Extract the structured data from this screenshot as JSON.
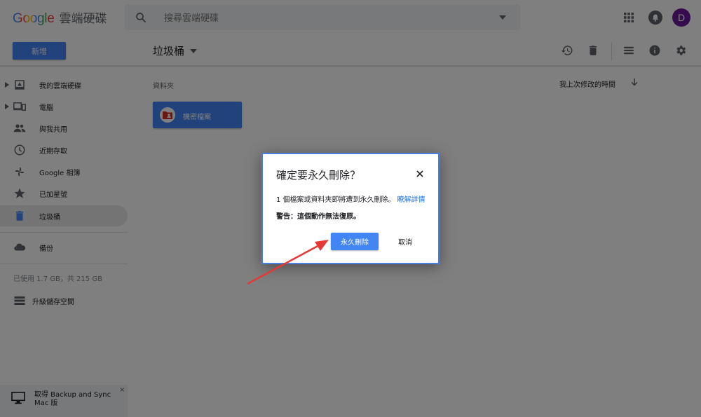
{
  "header": {
    "logo_google": "Google",
    "product_name": "雲端硬碟",
    "search_placeholder": "搜尋雲端硬碟",
    "avatar_initial": "D"
  },
  "toolbar": {
    "new_label": "新增",
    "location_title": "垃圾桶"
  },
  "sidebar": {
    "items": [
      {
        "label": "我的雲端硬碟",
        "icon": "drive-icon",
        "expandable": true
      },
      {
        "label": "電腦",
        "icon": "computers-icon",
        "expandable": true
      },
      {
        "label": "與我共用",
        "icon": "shared-icon",
        "expandable": false
      },
      {
        "label": "近期存取",
        "icon": "recent-icon",
        "expandable": false
      },
      {
        "label": "Google 相簿",
        "icon": "photos-icon",
        "expandable": false
      },
      {
        "label": "已加星號",
        "icon": "star-icon",
        "expandable": false
      },
      {
        "label": "垃圾桶",
        "icon": "trash-icon",
        "expandable": false,
        "active": true
      }
    ],
    "backups_label": "備份",
    "storage_text": "已使用 1.7 GB，共 215 GB",
    "upgrade_label": "升級儲存空間",
    "backup_promo": "取得 Backup and Sync Mac 版",
    "backup_close": "×"
  },
  "main": {
    "section_label": "資料夾",
    "sort_label": "我上次修改的時間",
    "folder_name": "機密檔案"
  },
  "dialog": {
    "title": "確定要永久刪除？",
    "body": "1 個檔案或資料夾即將遭到永久刪除。",
    "learn_more": "瞭解詳情",
    "warning": "警告：這個動作無法復原。",
    "confirm_label": "永久刪除",
    "cancel_label": "取消"
  },
  "colors": {
    "accent": "#4285f4",
    "link": "#1a73e8",
    "annotation": "#e53935",
    "avatar": "#6a1b9a",
    "folder_badge": "#d93025"
  }
}
